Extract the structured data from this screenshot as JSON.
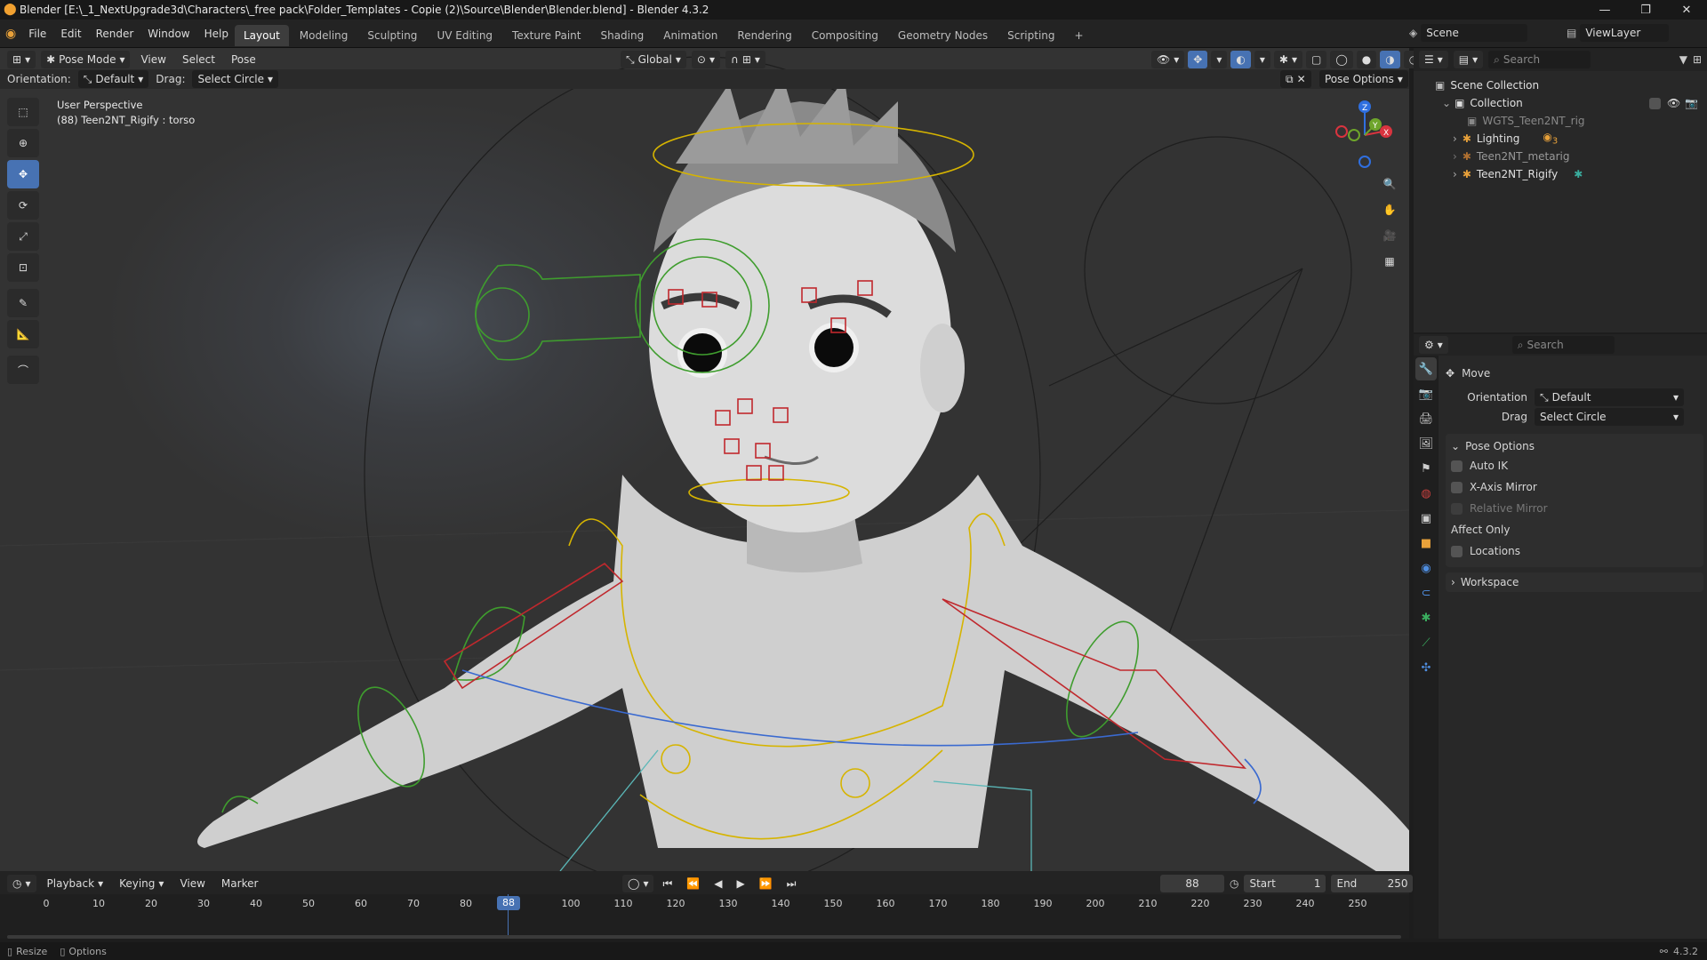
{
  "window": {
    "title": "Blender [E:\\_1_NextUpgrade3d\\Characters\\_free pack\\Folder_Templates - Copie (2)\\Source\\Blender\\Blender.blend] - Blender 4.3.2"
  },
  "topbar": {
    "menus": [
      "File",
      "Edit",
      "Render",
      "Window",
      "Help"
    ],
    "workspaces": [
      "Layout",
      "Modeling",
      "Sculpting",
      "UV Editing",
      "Texture Paint",
      "Shading",
      "Animation",
      "Rendering",
      "Compositing",
      "Geometry Nodes",
      "Scripting"
    ],
    "active_workspace": "Layout",
    "add_tab": "+",
    "scene_label": "Scene",
    "viewlayer_label": "ViewLayer"
  },
  "viewport_header": {
    "mode": "Pose Mode",
    "menus": [
      "View",
      "Select",
      "Pose"
    ],
    "transform_orientation": "Global",
    "orientation_label": "Orientation:",
    "orientation_value": "Default",
    "drag_label": "Drag:",
    "drag_value": "Select Circle",
    "pose_options": "Pose Options"
  },
  "viewport": {
    "perspective": "User Perspective",
    "object_info": "(88) Teen2NT_Rigify : torso",
    "gizmo_axes": [
      "Z",
      "Y",
      "X"
    ]
  },
  "outliner": {
    "search_placeholder": "Search",
    "rows": [
      {
        "label": "Scene Collection",
        "icon": "scene-collection-icon"
      },
      {
        "label": "Collection",
        "icon": "collection-icon"
      },
      {
        "label": "WGTS_Teen2NT_rig",
        "icon": "collection-icon"
      },
      {
        "label": "Lighting",
        "icon": "armature-icon",
        "badge": "3"
      },
      {
        "label": "Teen2NT_metarig",
        "icon": "armature-icon"
      },
      {
        "label": "Teen2NT_Rigify",
        "icon": "armature-icon"
      }
    ]
  },
  "properties": {
    "search_placeholder": "Search",
    "tool_name": "Move",
    "orientation_label": "Orientation",
    "orientation_value": "Default",
    "drag_label": "Drag",
    "drag_value": "Select Circle",
    "pose_options_header": "Pose Options",
    "auto_ik": "Auto IK",
    "x_axis_mirror": "X-Axis Mirror",
    "relative_mirror": "Relative Mirror",
    "affect_only": "Affect Only",
    "locations": "Locations",
    "workspace_header": "Workspace"
  },
  "timeline": {
    "menus": [
      "Playback",
      "Keying",
      "View",
      "Marker"
    ],
    "current_frame": "88",
    "start_label": "Start",
    "start_value": "1",
    "end_label": "End",
    "end_value": "250",
    "ticks": [
      "0",
      "10",
      "20",
      "30",
      "40",
      "50",
      "60",
      "70",
      "80",
      "100",
      "110",
      "120",
      "130",
      "140",
      "150",
      "160",
      "170",
      "180",
      "190",
      "200",
      "210",
      "220",
      "230",
      "240",
      "250"
    ]
  },
  "statusbar": {
    "resize": "Resize",
    "options": "Options",
    "version": "4.3.2"
  },
  "colors": {
    "accent_blue": "#4772b3",
    "bone_yellow": "#d6b400",
    "bone_red": "#c0282d",
    "bone_green": "#3f9d2e",
    "bone_blue": "#3a6ad0"
  }
}
